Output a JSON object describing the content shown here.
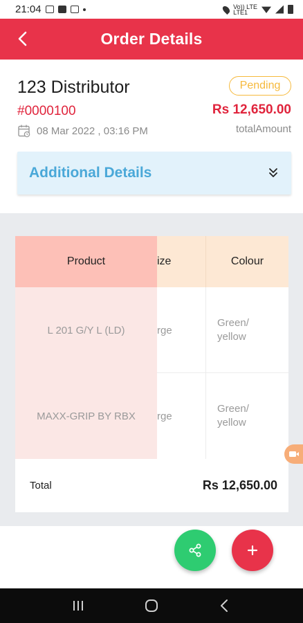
{
  "status_bar": {
    "time": "21:04",
    "network": "Vo)) LTE\nLTE1"
  },
  "app_bar": {
    "title": "Order Details",
    "back_icon": "chevron-left-icon"
  },
  "order": {
    "distributor": "123 Distributor",
    "status": "Pending",
    "order_id": "#0000100",
    "amount": "Rs 12,650.00",
    "amount_label": "totalAmount",
    "date": "08 Mar 2022 , 03:16 PM"
  },
  "additional": {
    "label": "Additional Details",
    "icon": "double-chevron-down-icon"
  },
  "table": {
    "headers": {
      "product": "Product",
      "size": "ize",
      "colour": "Colour"
    },
    "rows": [
      {
        "product": "L 201 G/Y L (LD)",
        "size": "rge",
        "colour": "Green/\nyellow"
      },
      {
        "product": "MAXX-GRIP BY RBX",
        "size": "rge",
        "colour": "Green/\nyellow"
      }
    ],
    "total_label": "Total",
    "total_value": "Rs 12,650.00"
  },
  "fabs": {
    "share_icon": "share-icon",
    "add_icon": "plus-icon"
  },
  "colors": {
    "primary": "#e8334a",
    "share": "#2ecc71",
    "pending": "#f6b93b",
    "accent_blue": "#4aa8d8"
  }
}
